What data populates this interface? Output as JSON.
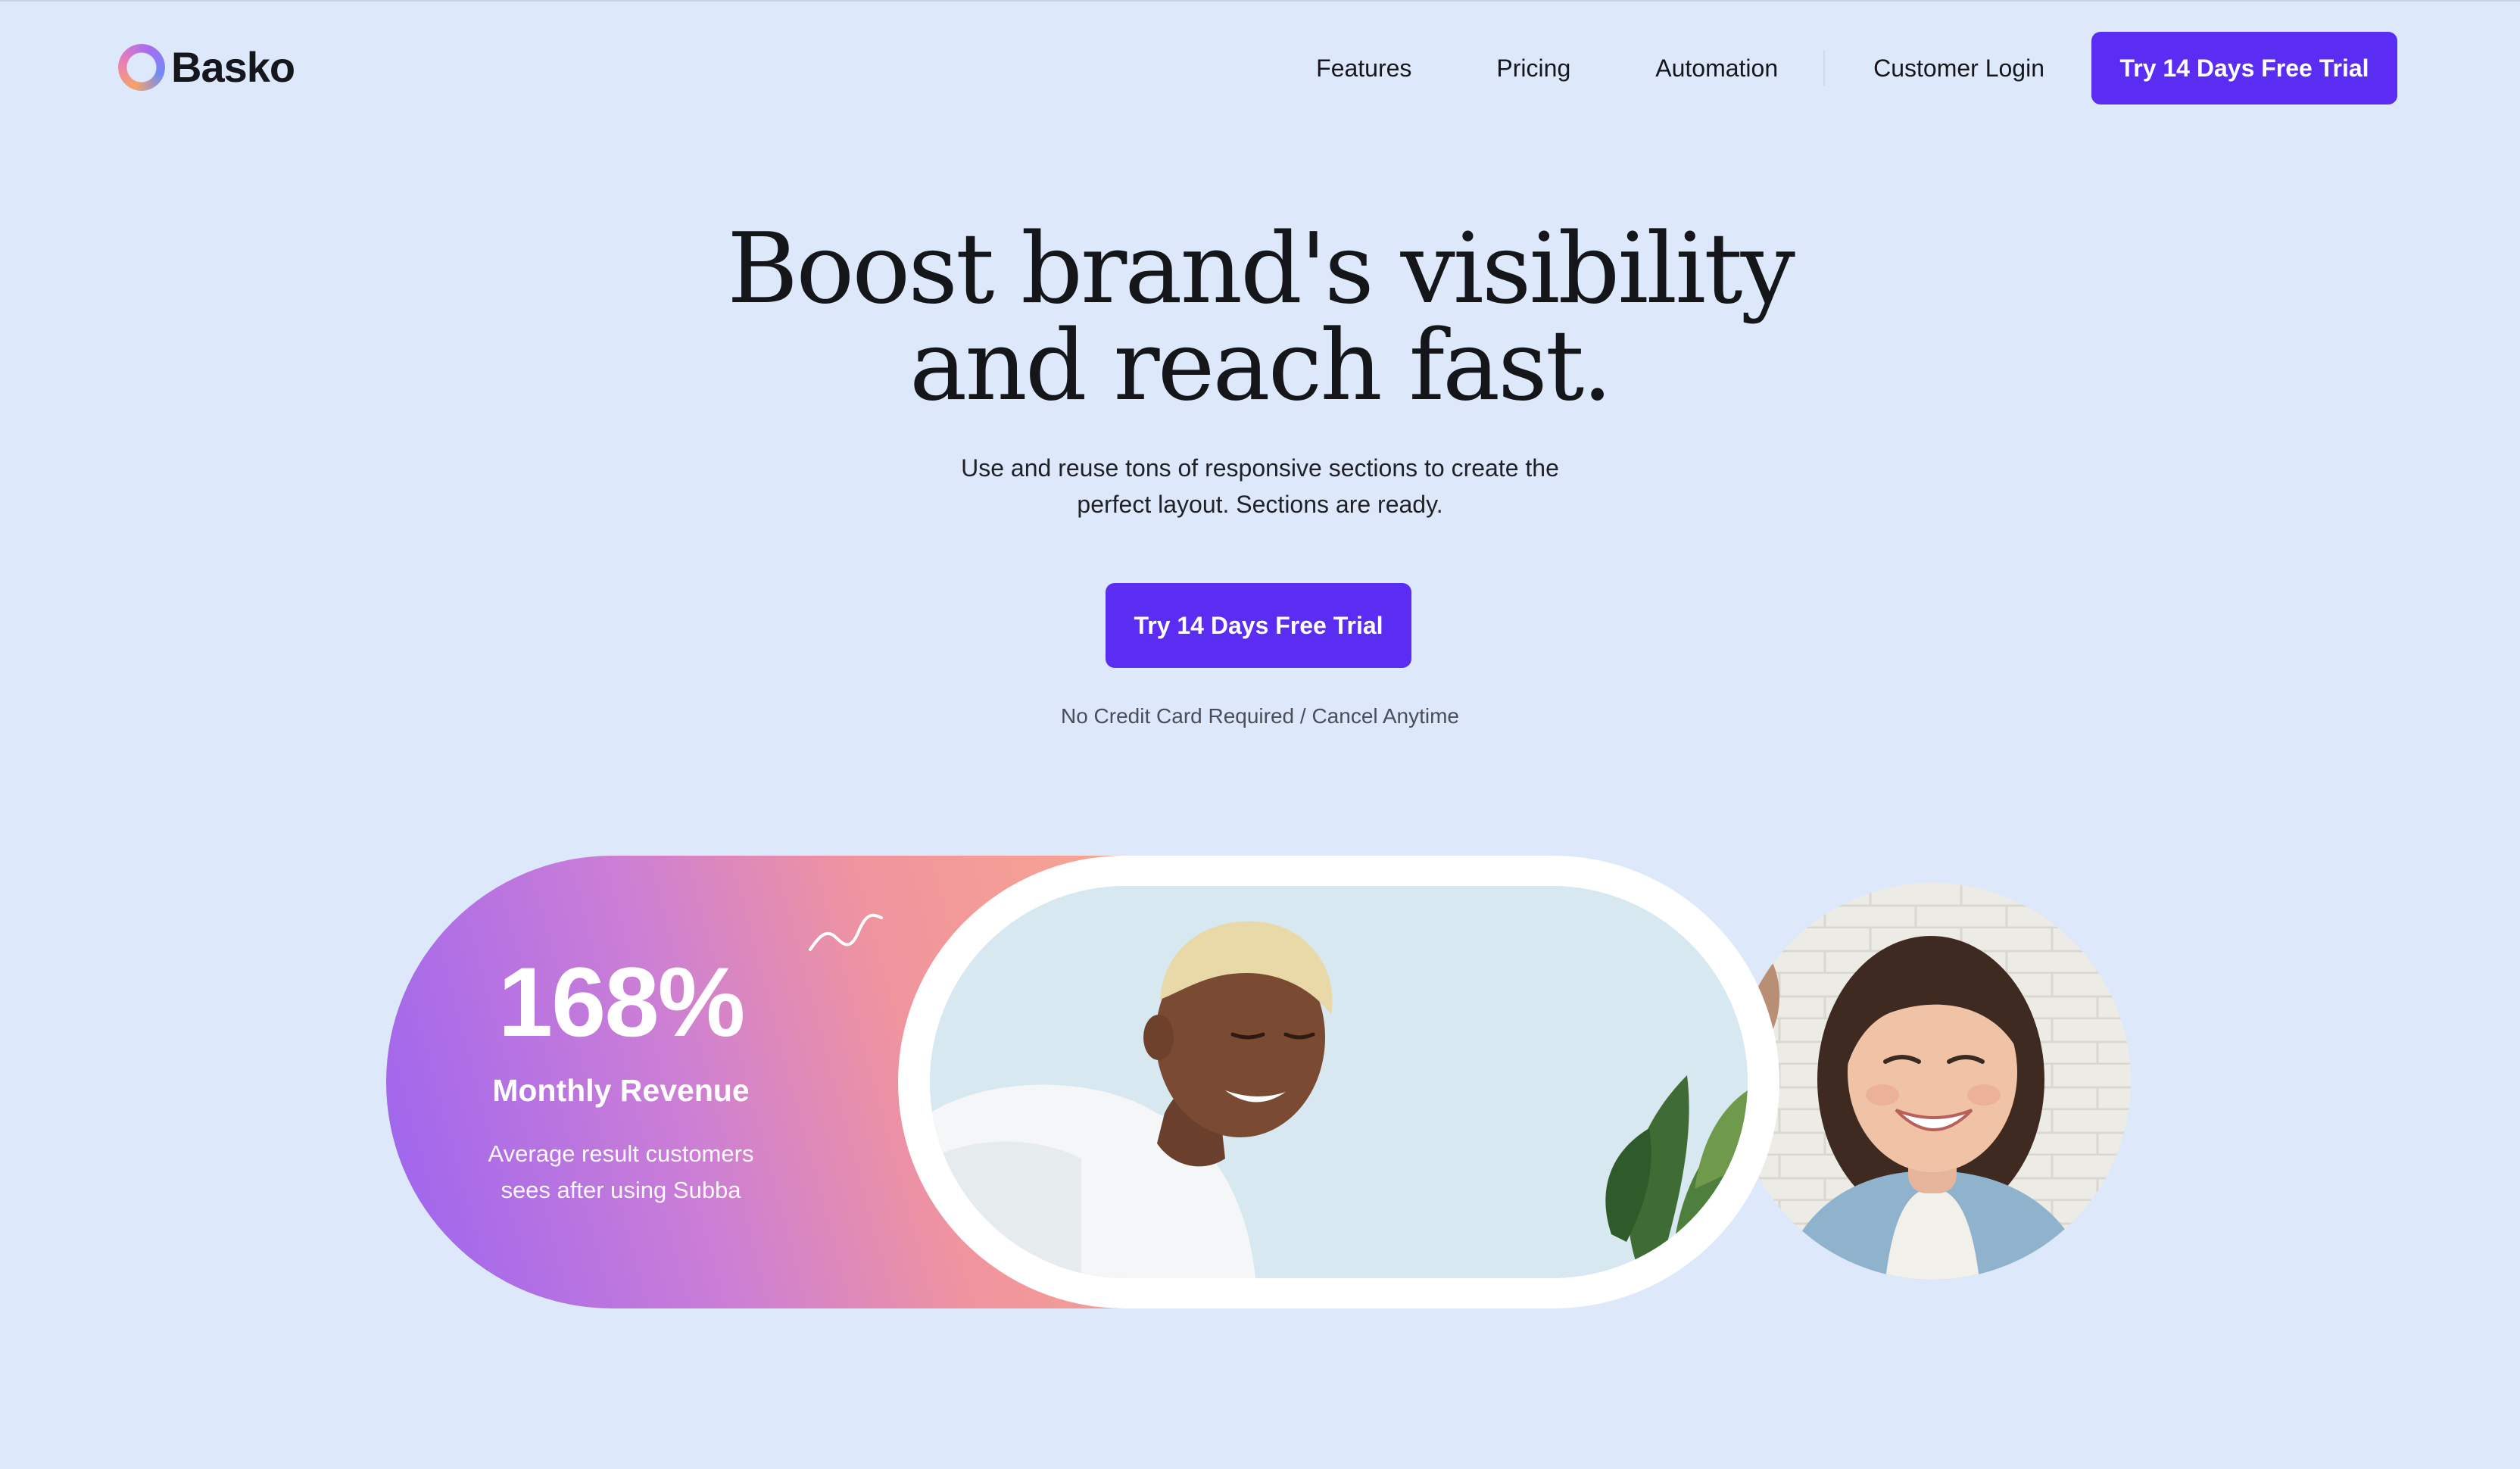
{
  "brand": {
    "name": "Basko"
  },
  "nav": {
    "items": [
      "Features",
      "Pricing",
      "Automation"
    ],
    "login": "Customer Login",
    "cta": "Try 14 Days Free Trial"
  },
  "hero": {
    "title_lines": [
      "Boost brand's visibility",
      "and reach fast."
    ],
    "subtitle_lines": [
      "Use and reuse tons of responsive sections to create the",
      "perfect layout. Sections are ready."
    ],
    "cta": "Try 14 Days Free Trial",
    "note": "No Credit Card Required / Cancel Anytime"
  },
  "stat": {
    "value": "168%",
    "label": "Monthly Revenue",
    "description_lines": [
      "Average result customers",
      "sees after using Subba"
    ]
  },
  "colors": {
    "primary": "#5b2df2",
    "background": "#dde8fa",
    "gradient_start": "#9a63f0",
    "gradient_end": "#f8a88f"
  },
  "icons": {
    "logo": "ring-logo-icon",
    "decoration": "squiggle-icon"
  }
}
